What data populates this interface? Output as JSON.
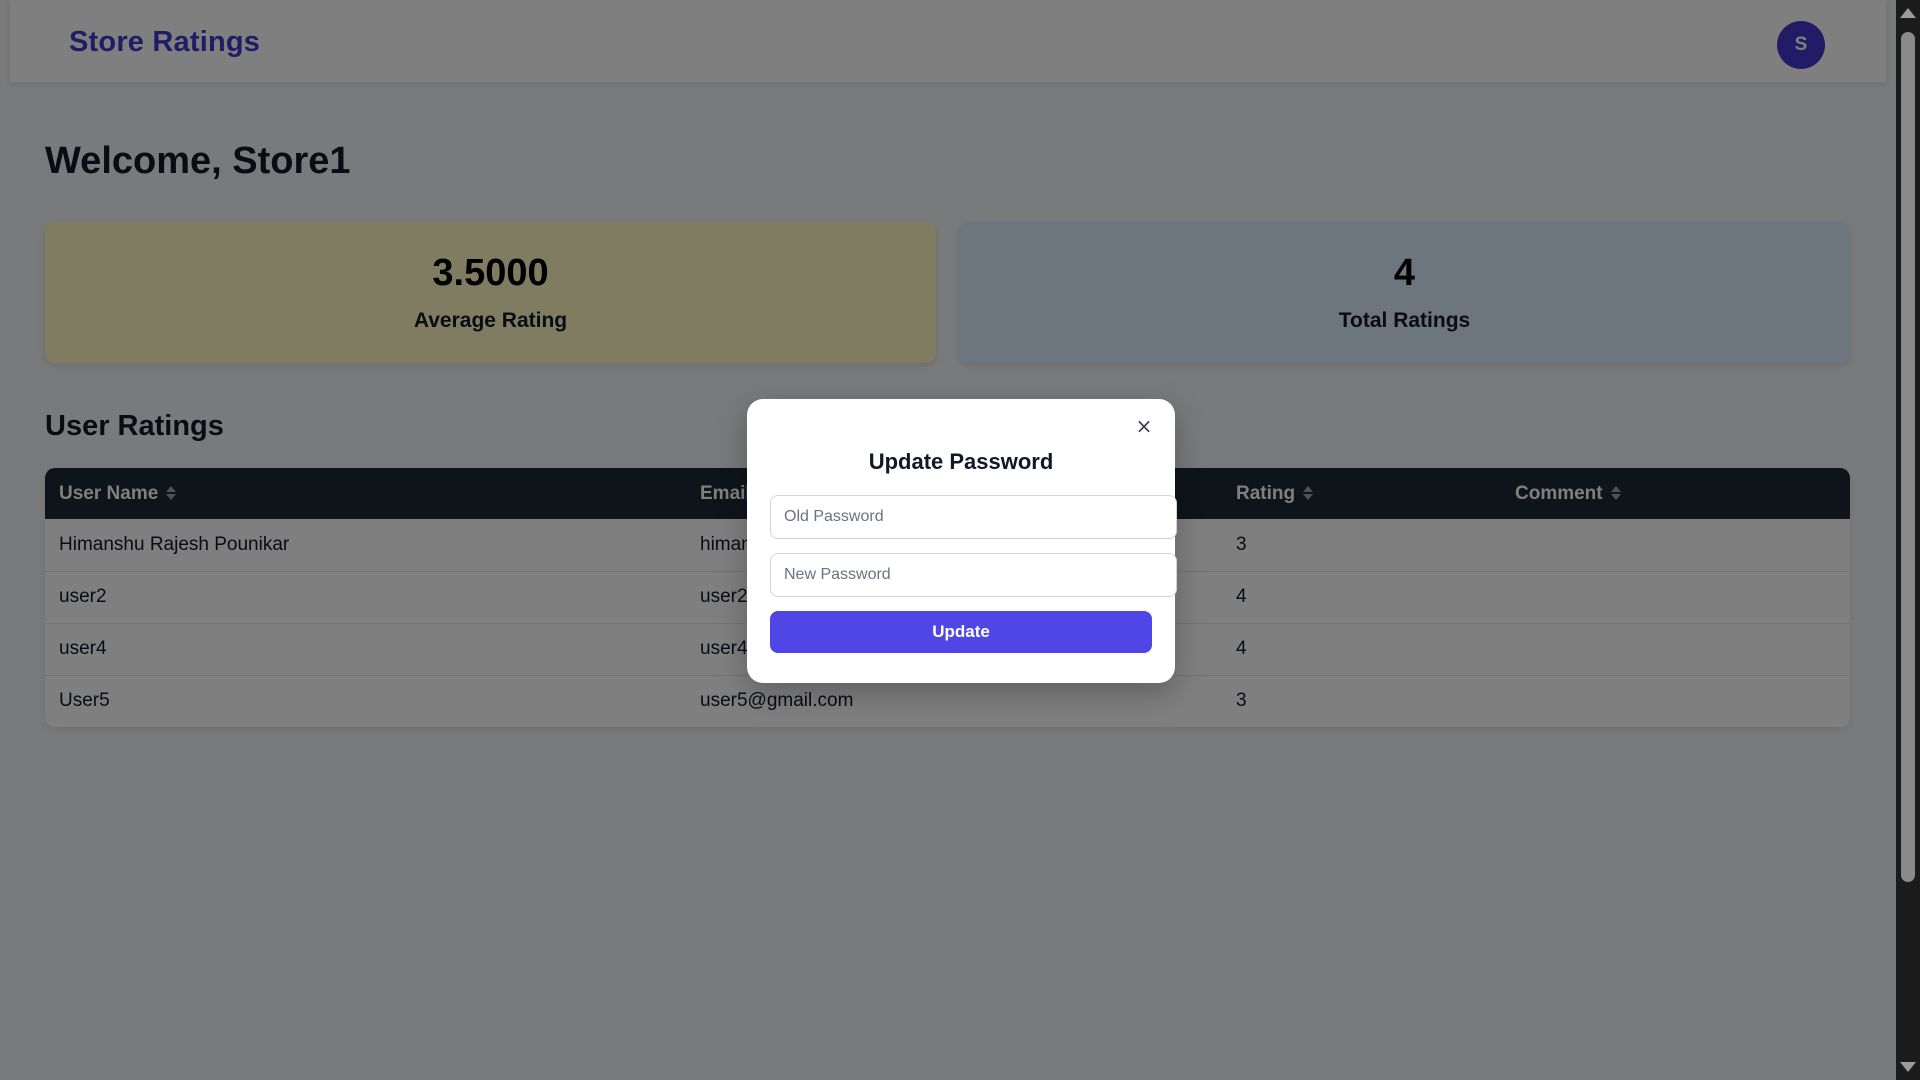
{
  "navbar": {
    "brand": "Store Ratings",
    "avatar_initial": "S"
  },
  "dashboard": {
    "welcome": "Welcome, Store1",
    "stats": {
      "average_value": "3.5000",
      "average_label": "Average Rating",
      "total_value": "4",
      "total_label": "Total Ratings"
    },
    "section_title": "User Ratings"
  },
  "table": {
    "headers": [
      "User Name",
      "Email",
      "Rating",
      "Comment"
    ],
    "rows": [
      {
        "name": "Himanshu Rajesh Pounikar",
        "email": "himan",
        "rating": "3",
        "comment": ""
      },
      {
        "name": "user2",
        "email": "user2",
        "rating": "4",
        "comment": ""
      },
      {
        "name": "user4",
        "email": "user4",
        "rating": "4",
        "comment": ""
      },
      {
        "name": "User5",
        "email": "user5@gmail.com",
        "rating": "3",
        "comment": ""
      }
    ]
  },
  "modal": {
    "title": "Update Password",
    "close_symbol": "×",
    "old_password_placeholder": "Old Password",
    "new_password_placeholder": "New Password",
    "submit_label": "Update"
  },
  "colors": {
    "brand": "#4338ca",
    "primary_button": "#4f46e5",
    "table_header": "#1f2937",
    "average_card": "#fef9c3",
    "total_card": "#dbeafe"
  },
  "icons": {
    "sort": "sort-icon",
    "close": "close-icon"
  }
}
